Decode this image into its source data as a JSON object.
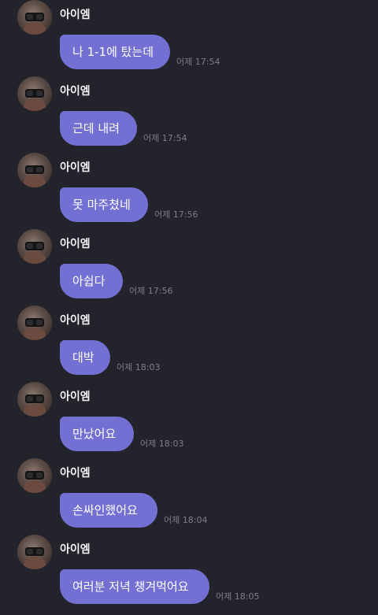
{
  "chat": {
    "messages": [
      {
        "sender": "아이엠",
        "text": "나 1-1에 탔는데",
        "time": "어제 17:54"
      },
      {
        "sender": "아이엠",
        "text": "근데 내려",
        "time": "어제 17:54"
      },
      {
        "sender": "아이엠",
        "text": "못 마주쳤네",
        "time": "어제 17:56"
      },
      {
        "sender": "아이엠",
        "text": "아쉽다",
        "time": "어제 17:56"
      },
      {
        "sender": "아이엠",
        "text": "대박",
        "time": "어제 18:03"
      },
      {
        "sender": "아이엠",
        "text": "만났어요",
        "time": "어제 18:03"
      },
      {
        "sender": "아이엠",
        "text": "손싸인했어요",
        "time": "어제 18:04"
      },
      {
        "sender": "아이엠",
        "text": "여러분 저녁 챙겨먹어요",
        "time": "어제 18:05"
      }
    ]
  },
  "colors": {
    "background": "#23242b",
    "bubble": "#7370d3",
    "bubble_text": "#ffffff",
    "name_text": "#f1f1f3",
    "time_text": "#7c7d86"
  }
}
